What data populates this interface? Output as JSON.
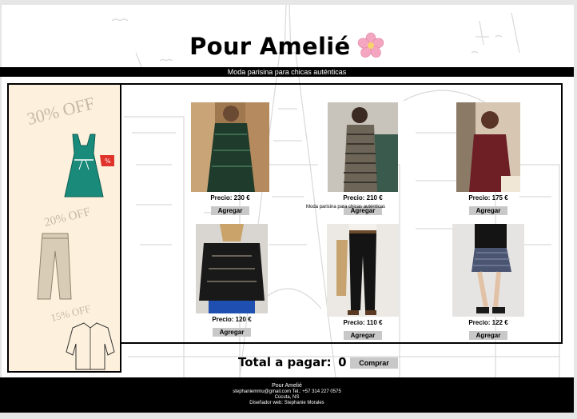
{
  "header": {
    "title": "Pour Amelié",
    "tagline": "Moda parisina para chicas auténticas"
  },
  "sidebar": {
    "promos": [
      {
        "label": "30% OFF",
        "item_icon": "dress-icon"
      },
      {
        "label": "20% OFF",
        "item_icon": "trousers-icon"
      },
      {
        "label": "15% OFF",
        "item_icon": "blouse-icon"
      }
    ]
  },
  "products": [
    {
      "name": "green-sequin-dress",
      "price": "Precio: 230 €",
      "button": "Agregar"
    },
    {
      "name": "houndstooth-dress",
      "price": "Precio: 210 €",
      "button": "Agregar"
    },
    {
      "name": "burgundy-cardigan",
      "price": "Precio: 175 €",
      "button": "Agregar"
    },
    {
      "name": "black-lace-blouse",
      "price": "Precio: 120 €",
      "button": "Agregar"
    },
    {
      "name": "black-trousers",
      "price": "Precio: 110 €",
      "button": "Agregar"
    },
    {
      "name": "tweed-skirt",
      "price": "Precio: 122 €",
      "button": "Agregar"
    }
  ],
  "overlay_text": "Moda parisina para chicas auténticas",
  "cart": {
    "total_label": "Total a pagar:",
    "total_value": "0 €",
    "buy_button": "Comprar"
  },
  "footer": {
    "brand": "Pour Amelié",
    "contact": "stephaniemmu@gmail.com Tel.: +57 314 227 0575",
    "city": "Cúcuta, NS",
    "designer": "Diseñador web: Stephanie Morales"
  },
  "colors": {
    "sidebar_bg": "#fdf1dd",
    "promo_text": "#c7b8a6",
    "button_bg": "#c8c8c8",
    "bar_bg": "#000000",
    "flower": "#f4a6c0"
  }
}
